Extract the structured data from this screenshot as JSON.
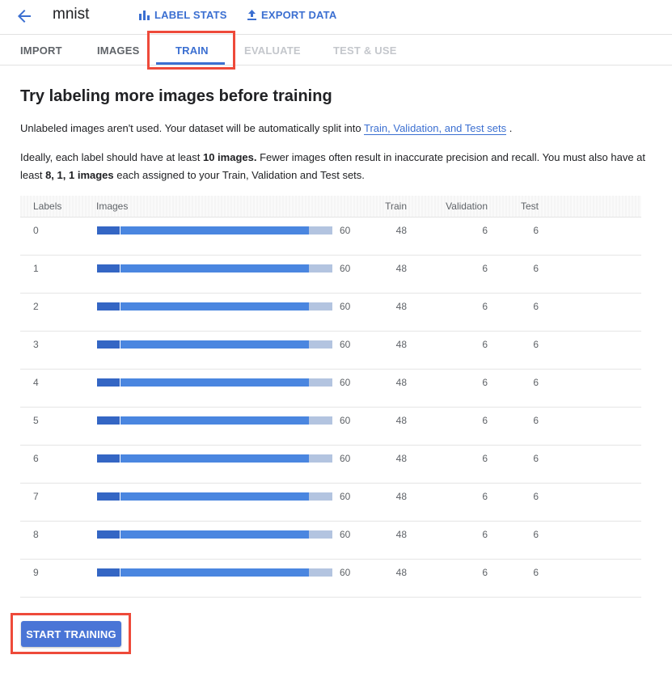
{
  "header": {
    "dataset_name": "mnist",
    "label_stats": "LABEL STATS",
    "export_data": "EXPORT DATA"
  },
  "tabs": [
    {
      "label": "IMPORT",
      "state": "enabled"
    },
    {
      "label": "IMAGES",
      "state": "enabled"
    },
    {
      "label": "TRAIN",
      "state": "active"
    },
    {
      "label": "EVALUATE",
      "state": "disabled"
    },
    {
      "label": "TEST & USE",
      "state": "disabled"
    }
  ],
  "main": {
    "heading": "Try labeling more images before training",
    "para1_prefix": "Unlabeled images aren't used. Your dataset will be automatically split into ",
    "para1_link": "Train, Validation, and Test sets",
    "para1_suffix": " .",
    "para2_a": "Ideally, each label should have at least ",
    "para2_b": "10 images.",
    "para2_c": " Fewer images often result in inaccurate precision and recall. You must also have at least ",
    "para2_d": "8, 1, 1 images",
    "para2_e": " each assigned to your Train, Validation and Test sets."
  },
  "table": {
    "headers": {
      "labels": "Labels",
      "images": "Images",
      "train": "Train",
      "validation": "Validation",
      "test": "Test"
    },
    "rows": [
      {
        "label": "0",
        "images": "60",
        "train": "48",
        "validation": "6",
        "test": "6"
      },
      {
        "label": "1",
        "images": "60",
        "train": "48",
        "validation": "6",
        "test": "6"
      },
      {
        "label": "2",
        "images": "60",
        "train": "48",
        "validation": "6",
        "test": "6"
      },
      {
        "label": "3",
        "images": "60",
        "train": "48",
        "validation": "6",
        "test": "6"
      },
      {
        "label": "4",
        "images": "60",
        "train": "48",
        "validation": "6",
        "test": "6"
      },
      {
        "label": "5",
        "images": "60",
        "train": "48",
        "validation": "6",
        "test": "6"
      },
      {
        "label": "6",
        "images": "60",
        "train": "48",
        "validation": "6",
        "test": "6"
      },
      {
        "label": "7",
        "images": "60",
        "train": "48",
        "validation": "6",
        "test": "6"
      },
      {
        "label": "8",
        "images": "60",
        "train": "48",
        "validation": "6",
        "test": "6"
      },
      {
        "label": "9",
        "images": "60",
        "train": "48",
        "validation": "6",
        "test": "6"
      }
    ]
  },
  "actions": {
    "start_training": "START TRAINING"
  },
  "colors": {
    "accent": "#3b6fd1",
    "highlight": "#ee4a3a",
    "bar_dark": "#3466c4",
    "bar_mid": "#4a86e0",
    "bar_light": "#b3c4e0"
  },
  "icons": {
    "back": "arrow-back-icon",
    "label_stats": "bar-chart-icon",
    "export": "upload-icon"
  }
}
